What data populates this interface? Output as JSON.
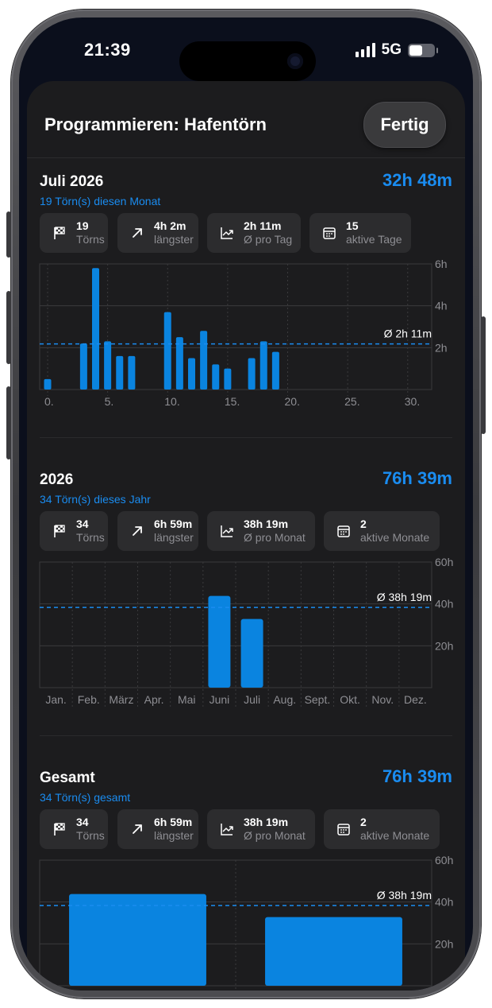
{
  "status_bar": {
    "time": "21:39",
    "network": "5G"
  },
  "sheet": {
    "title": "Programmieren: Hafentörn",
    "done_label": "Fertig"
  },
  "month": {
    "title": "Juli 2026",
    "subtitle": "19 Törn(s) diesen Monat",
    "total": "32h 48m",
    "stats": [
      {
        "icon": "flag-checkered-icon",
        "value": "19",
        "label": "Törns"
      },
      {
        "icon": "arrow-up-right-icon",
        "value": "4h 2m",
        "label": "längster"
      },
      {
        "icon": "trend-chart-icon",
        "value": "2h 11m",
        "label": "Ø pro Tag"
      },
      {
        "icon": "calendar-icon",
        "value": "15",
        "label": "aktive Tage"
      }
    ],
    "chart_data": {
      "type": "bar",
      "x": [
        0,
        3,
        4,
        5,
        6,
        7,
        10,
        11,
        12,
        13,
        14,
        15,
        17,
        18,
        19
      ],
      "values": [
        0.5,
        2.2,
        5.8,
        2.3,
        1.6,
        1.6,
        3.7,
        2.5,
        1.5,
        2.8,
        1.2,
        1.0,
        1.5,
        2.3,
        1.8
      ],
      "unit": "h",
      "x_ticks": [
        "0.",
        "5.",
        "10.",
        "15.",
        "20.",
        "25.",
        "30."
      ],
      "y_ticks": [
        "6h",
        "4h",
        "2h"
      ],
      "ylim": [
        0,
        6
      ],
      "xlim": [
        0,
        32
      ],
      "average": 2.18,
      "average_label": "Ø 2h 11m",
      "color": "#0a84e0"
    }
  },
  "year": {
    "title": "2026",
    "subtitle": "34 Törn(s) dieses Jahr",
    "total": "76h 39m",
    "stats": [
      {
        "icon": "flag-checkered-icon",
        "value": "34",
        "label": "Törns"
      },
      {
        "icon": "arrow-up-right-icon",
        "value": "6h 59m",
        "label": "längster"
      },
      {
        "icon": "trend-chart-icon",
        "value": "38h 19m",
        "label": "Ø pro Monat"
      },
      {
        "icon": "calendar-icon",
        "value": "2",
        "label": "aktive Monate"
      }
    ],
    "chart_data": {
      "type": "bar",
      "categories": [
        "Jan.",
        "Feb.",
        "März",
        "Apr.",
        "Mai",
        "Juni",
        "Juli",
        "Aug.",
        "Sept.",
        "Okt.",
        "Nov.",
        "Dez."
      ],
      "values": [
        0,
        0,
        0,
        0,
        0,
        43.8,
        32.8,
        0,
        0,
        0,
        0,
        0
      ],
      "unit": "h",
      "y_ticks": [
        "60h",
        "40h",
        "20h"
      ],
      "ylim": [
        0,
        60
      ],
      "average": 38.3,
      "average_label": "Ø 38h 19m",
      "color": "#0a84e0"
    }
  },
  "total": {
    "title": "Gesamt",
    "subtitle": "34 Törn(s) gesamt",
    "total": "76h 39m",
    "stats": [
      {
        "icon": "flag-checkered-icon",
        "value": "34",
        "label": "Törns"
      },
      {
        "icon": "arrow-up-right-icon",
        "value": "6h 59m",
        "label": "längster"
      },
      {
        "icon": "trend-chart-icon",
        "value": "38h 19m",
        "label": "Ø pro Monat"
      },
      {
        "icon": "calendar-icon",
        "value": "2",
        "label": "aktive Monate"
      }
    ],
    "chart_data": {
      "type": "bar",
      "categories": [
        "",
        ""
      ],
      "values": [
        43.8,
        32.8
      ],
      "unit": "h",
      "y_ticks": [
        "60h",
        "40h",
        "20h"
      ],
      "ylim": [
        0,
        60
      ],
      "average": 38.3,
      "average_label": "Ø 38h 19m",
      "color": "#0a84e0"
    }
  }
}
